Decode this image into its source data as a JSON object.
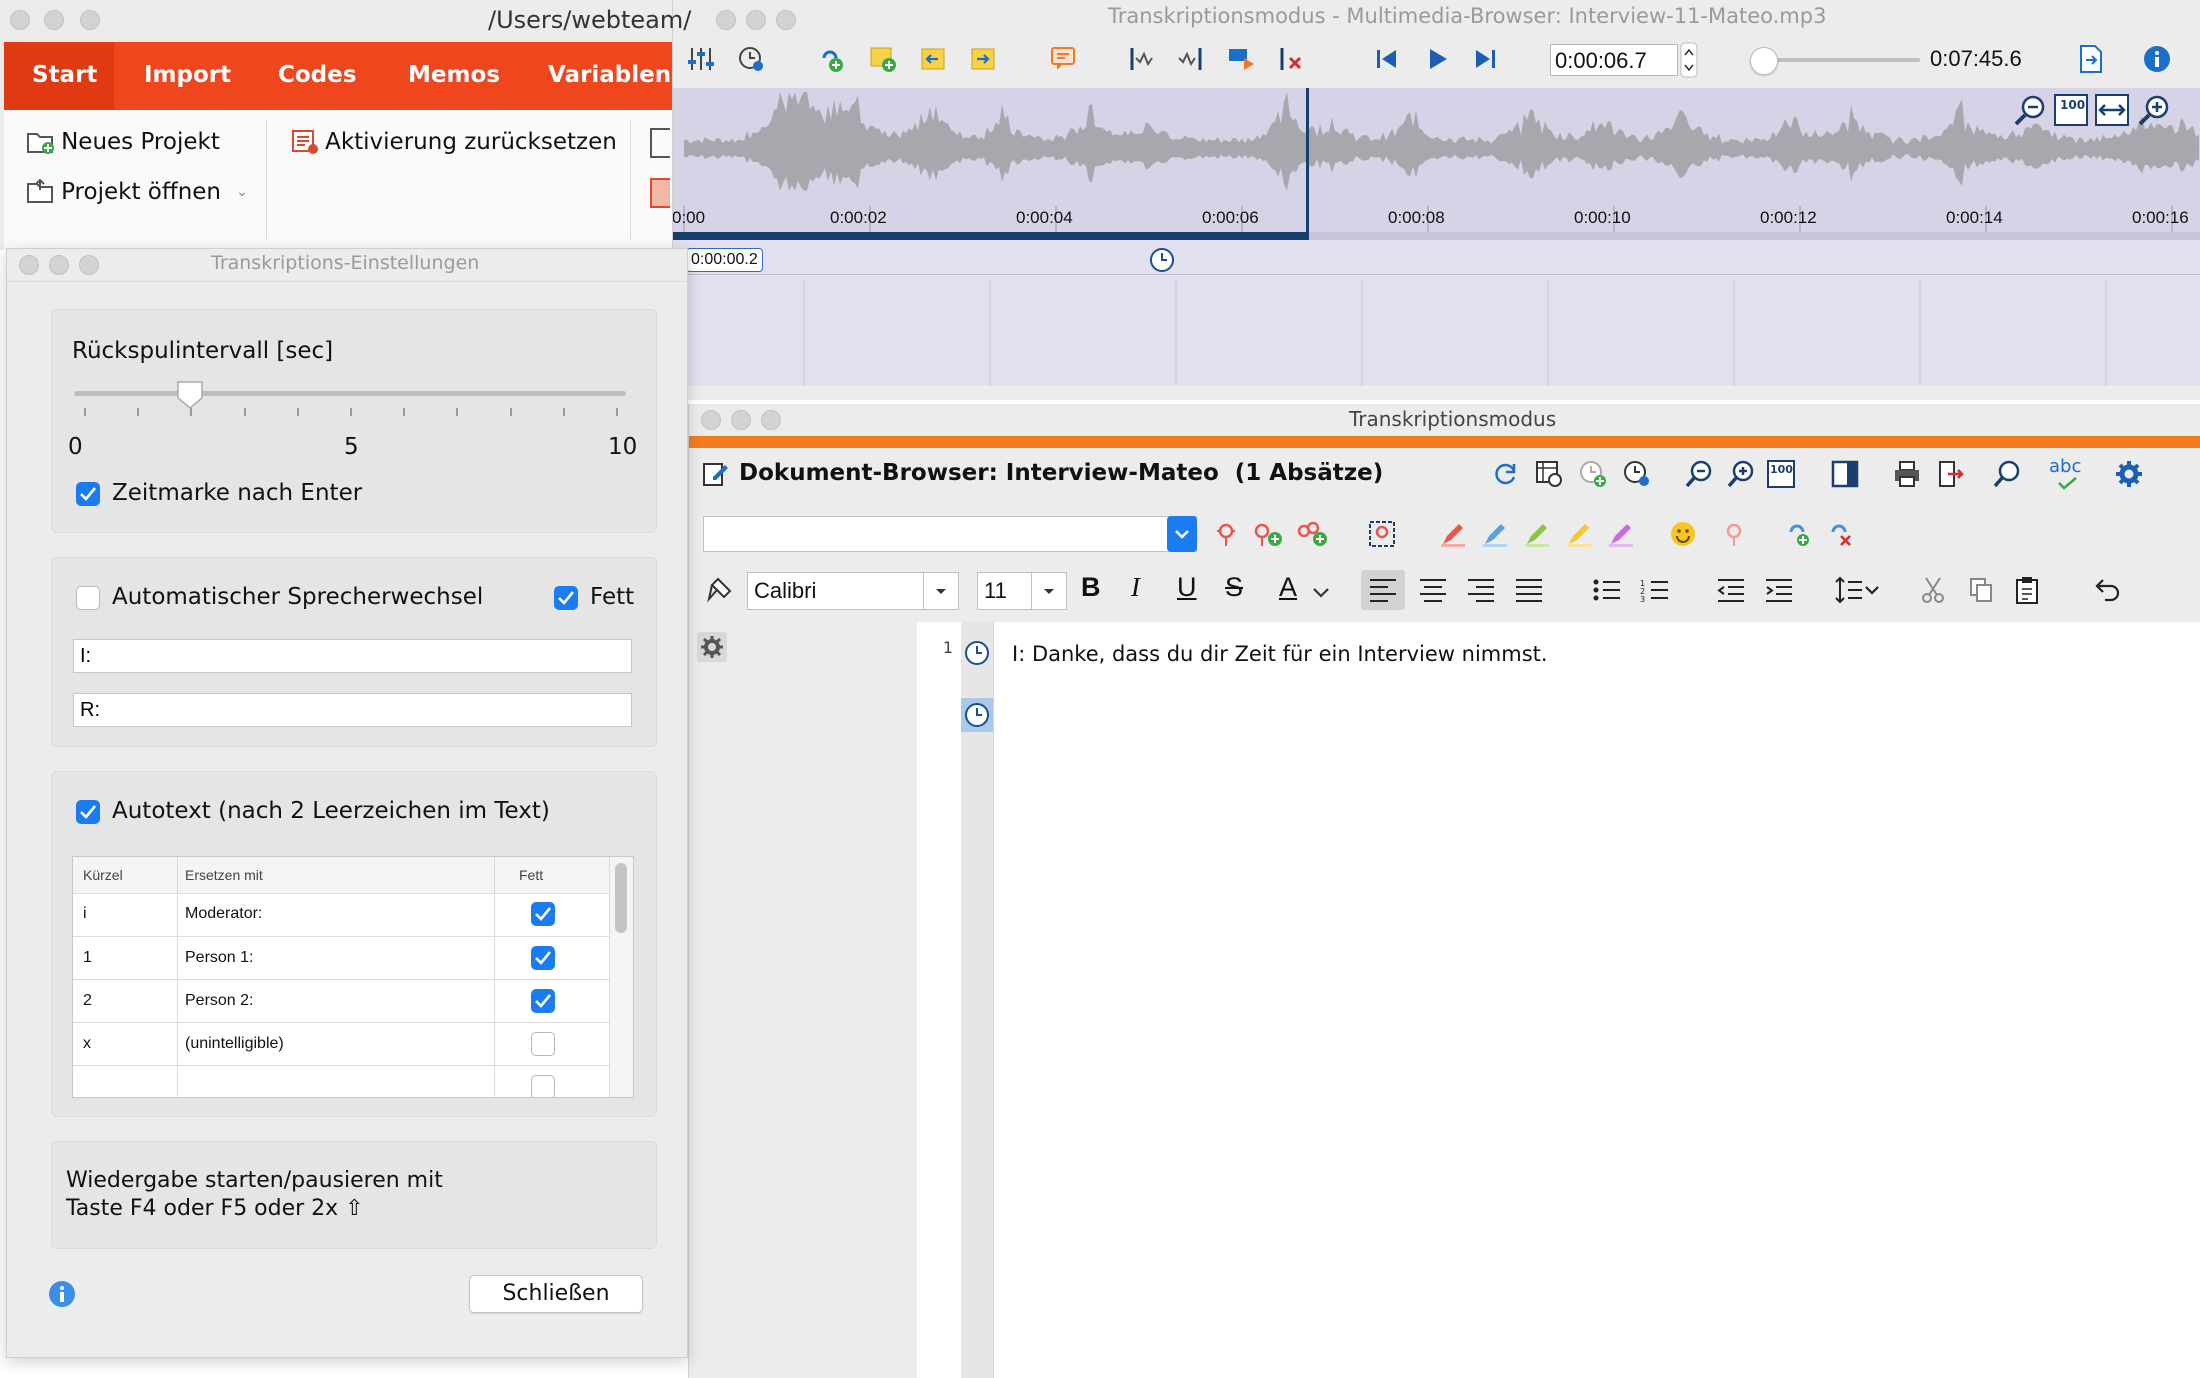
{
  "main_window": {
    "path_title": "/Users/webteam/",
    "ribbon_tabs": [
      "Start",
      "Import",
      "Codes",
      "Memos",
      "Variablen"
    ],
    "ribbon_accent": "#f0461e",
    "new_project": "Neues Projekt",
    "open_project": "Projekt öffnen",
    "reset_activation": "Aktivierung zurücksetzen"
  },
  "multimedia": {
    "title": "Transkriptionsmodus - Multimedia-Browser:  Interview-11-Mateo.mp3",
    "current_time": "0:00:06.7",
    "total_time": "0:07:45.6",
    "timeline_ticks": [
      "0:00",
      "0:00:02",
      "0:00:04",
      "0:00:06",
      "0:00:08",
      "0:00:10",
      "0:00:12",
      "0:00:14",
      "0:00:16"
    ],
    "marker_time": "0:00:00.2",
    "zoom_100": "100",
    "playback_position_fraction": 0.42
  },
  "transcription_window": {
    "title": "Transkriptionsmodus",
    "doc_title": "Dokument-Browser: Interview-Mateo",
    "paragraph_count": "(1 Absätze)",
    "font_name": "Calibri",
    "font_size": "11",
    "abc": "abc",
    "para_number": "1",
    "text": "I: Danke, dass du dir Zeit für ein Interview nimmst.",
    "accent": "#f47c20"
  },
  "settings": {
    "title": "Transkriptions-Einstellungen",
    "rewind_label": "Rückspulintervall [sec]",
    "slider_min": "0",
    "slider_mid": "5",
    "slider_max": "10",
    "rewind_value": 2,
    "timestamp_label": "Zeitmarke nach Enter",
    "timestamp_checked": true,
    "auto_speaker_label": "Automatischer Sprecherwechsel",
    "auto_speaker_checked": false,
    "bold_label": "Fett",
    "bold_checked": true,
    "speaker1": "I:",
    "speaker2": "R:",
    "autotext_label": "Autotext (nach 2 Leerzeichen im Text)",
    "autotext_checked": true,
    "table_headers": [
      "Kürzel",
      "Ersetzen mit",
      "Fett"
    ],
    "table_rows": [
      {
        "short": "i",
        "replace": "Moderator:",
        "bold": true
      },
      {
        "short": "1",
        "replace": "Person 1:",
        "bold": true
      },
      {
        "short": "2",
        "replace": "Person 2:",
        "bold": true
      },
      {
        "short": "x",
        "replace": "(unintelligible)",
        "bold": false
      },
      {
        "short": "",
        "replace": "",
        "bold": false
      }
    ],
    "playback_hint_line1": "Wiedergabe starten/pausieren mit",
    "playback_hint_line2": "Taste F4 oder F5 oder 2x ⇧",
    "close_button": "Schließen"
  }
}
